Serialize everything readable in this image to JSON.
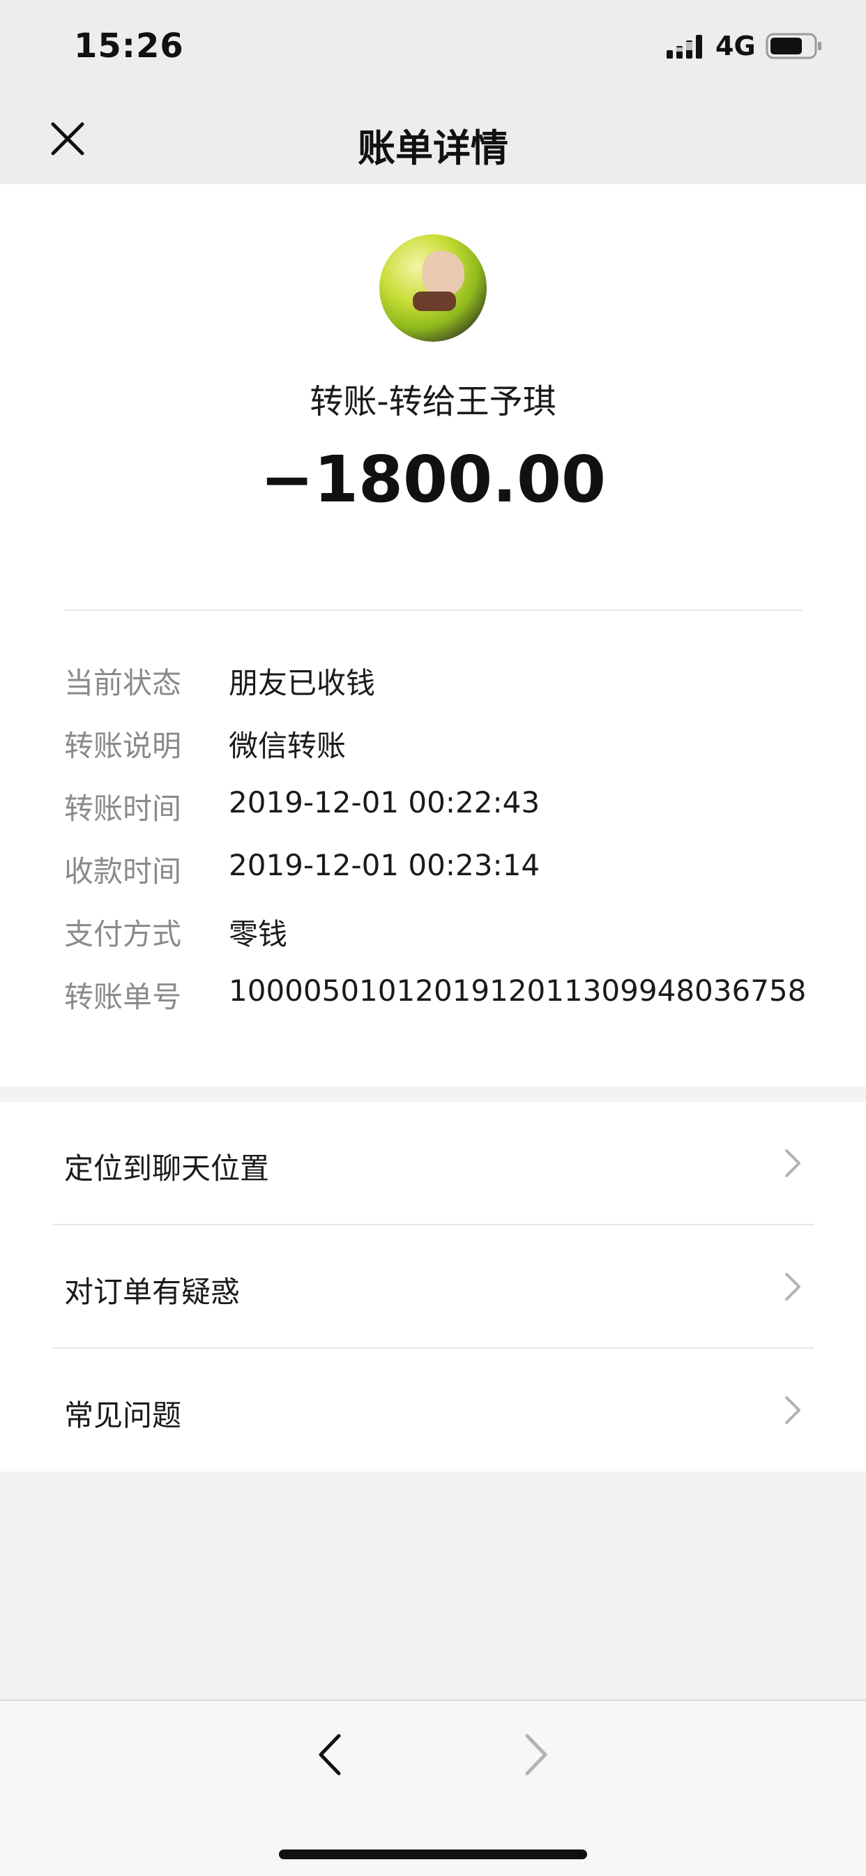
{
  "status_bar": {
    "time": "15:26",
    "network": "4G",
    "battery_level": 0.75
  },
  "nav": {
    "title": "账单详情",
    "close_icon": "close-icon"
  },
  "transfer": {
    "title": "转账-转给王予琪",
    "amount": "−1800.00"
  },
  "details": [
    {
      "label": "当前状态",
      "value": "朋友已收钱"
    },
    {
      "label": "转账说明",
      "value": "微信转账"
    },
    {
      "label": "转账时间",
      "value": "2019-12-01 00:22:43"
    },
    {
      "label": "收款时间",
      "value": "2019-12-01 00:23:14"
    },
    {
      "label": "支付方式",
      "value": "零钱"
    },
    {
      "label": "转账单号",
      "value": "1000050101201912011309948036758"
    }
  ],
  "menu": [
    {
      "label": "定位到聊天位置",
      "icon": "chevron-right-icon"
    },
    {
      "label": "对订单有疑惑",
      "icon": "chevron-right-icon"
    },
    {
      "label": "常见问题",
      "icon": "chevron-right-icon"
    }
  ],
  "toolbar": {
    "back_icon": "chevron-left-icon",
    "forward_icon": "chevron-right-icon"
  }
}
